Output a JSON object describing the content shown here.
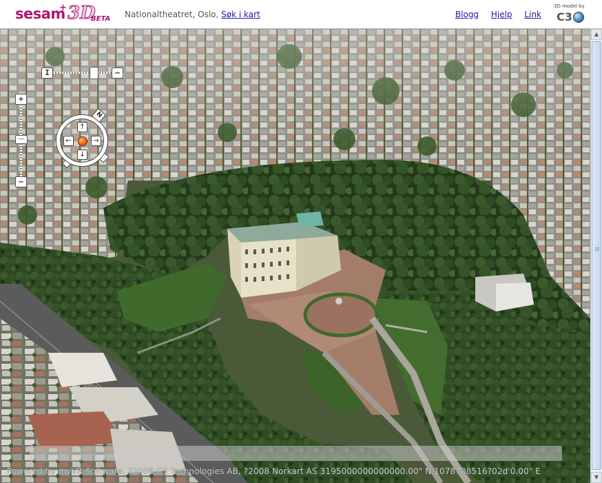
{
  "header": {
    "logo_text": "sesam",
    "logo_plus": "+",
    "logo_3d": "3D",
    "logo_beta": "BETA",
    "location_text": "Nationaltheatret, Oslo,",
    "search_map_link": "Søk i kart",
    "nav": [
      {
        "label": "Blogg"
      },
      {
        "label": "Hjelp"
      },
      {
        "label": "Link"
      }
    ],
    "c3_small": "3D model by",
    "c3_text": "C3"
  },
  "controls": {
    "tilt_minus": "I",
    "tilt_plus": "—",
    "zoom_in": "+",
    "zoom_out": "—",
    "zoom_mid": "—",
    "compass_north": "N",
    "compass_up": "↑",
    "compass_down": "↓",
    "compass_left": "←",
    "compass_right": "→"
  },
  "footer": {
    "credits": "Powered by myVR Software, ?2008 C3 Technologies AB, ?2008 Norkart AS 3195000000000000.00\" N   1078708516?02d'0.00\" E"
  },
  "colors": {
    "brand": "#b0156f",
    "link": "#1a1aa6",
    "forest": "#2f4a22",
    "plaza": "#a07a66",
    "city_roof": "#9a9a94"
  }
}
